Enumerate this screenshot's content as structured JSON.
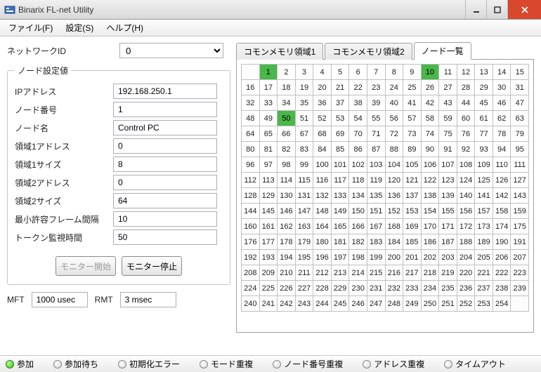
{
  "window": {
    "title": "Binarix FL-net Utility"
  },
  "menu": {
    "file": "ファイル(F)",
    "settings": "設定(S)",
    "help": "ヘルプ(H)"
  },
  "netid": {
    "label": "ネットワークID",
    "value": "0"
  },
  "nodeset": {
    "legend": "ノード設定値",
    "ip": {
      "label": "IPアドレス",
      "value": "192.168.250.1"
    },
    "nodeno": {
      "label": "ノード番号",
      "value": "1"
    },
    "nodename": {
      "label": "ノード名",
      "value": "Control PC"
    },
    "area1addr": {
      "label": "領域1アドレス",
      "value": "0"
    },
    "area1size": {
      "label": "領域1サイズ",
      "value": "8"
    },
    "area2addr": {
      "label": "領域2アドレス",
      "value": "0"
    },
    "area2size": {
      "label": "領域2サイズ",
      "value": "64"
    },
    "minframe": {
      "label": "最小許容フレーム間隔",
      "value": "10"
    },
    "tokenwatch": {
      "label": "トークン監視時間",
      "value": "50"
    }
  },
  "buttons": {
    "start": "モニター開始",
    "stop": "モニター停止"
  },
  "timers": {
    "mft_label": "MFT",
    "mft_value": "1000 usec",
    "rmt_label": "RMT",
    "rmt_value": "3 msec"
  },
  "tabs": {
    "t1": "コモンメモリ領域1",
    "t2": "コモンメモリ領域2",
    "t3": "ノード一覧"
  },
  "nodelist": {
    "max": 254,
    "active": [
      1,
      10,
      50
    ]
  },
  "status": {
    "join": "参加",
    "wait": "参加待ち",
    "initerr": "初期化エラー",
    "modedup": "モード重複",
    "nodenodup": "ノード番号重複",
    "addrdup": "アドレス重複",
    "timeout": "タイムアウト",
    "on": [
      "join"
    ]
  }
}
